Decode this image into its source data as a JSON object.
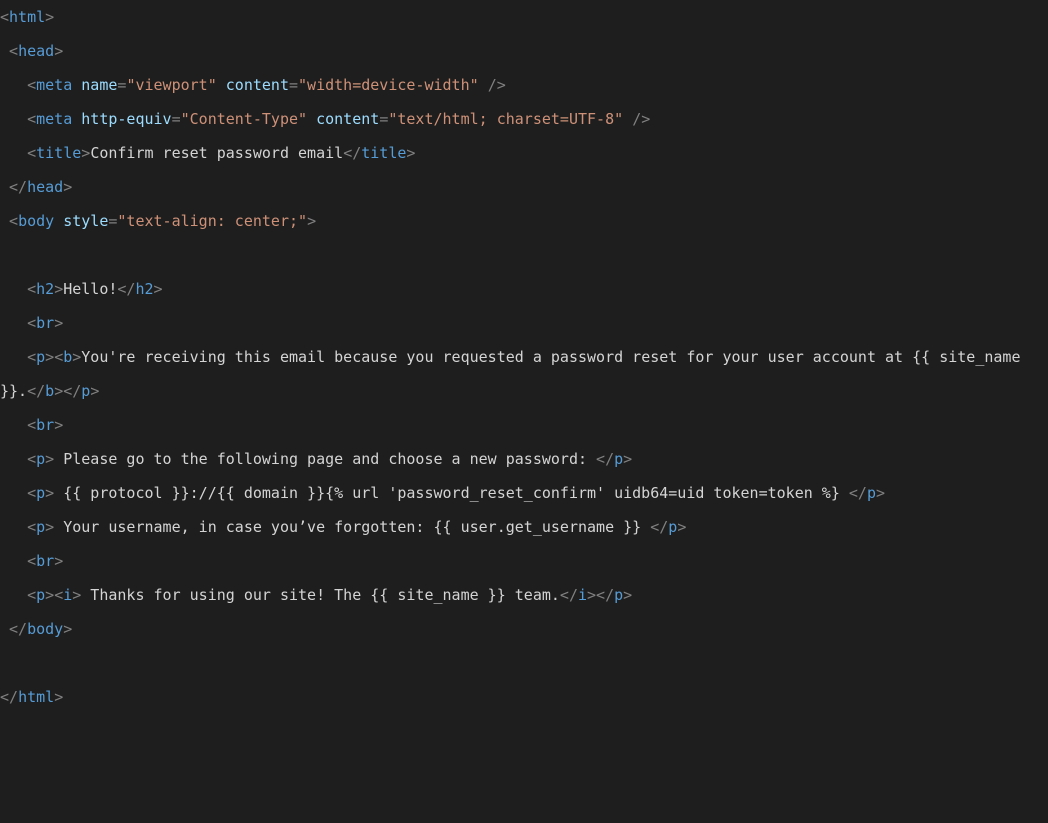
{
  "lines": [
    [
      {
        "cls": "punc",
        "t": "<"
      },
      {
        "cls": "tag",
        "t": "html"
      },
      {
        "cls": "punc",
        "t": ">"
      }
    ],
    [
      {
        "cls": "txt",
        "t": " "
      },
      {
        "cls": "punc",
        "t": "<"
      },
      {
        "cls": "tag",
        "t": "head"
      },
      {
        "cls": "punc",
        "t": ">"
      }
    ],
    [
      {
        "cls": "txt",
        "t": "   "
      },
      {
        "cls": "punc",
        "t": "<"
      },
      {
        "cls": "tag",
        "t": "meta"
      },
      {
        "cls": "txt",
        "t": " "
      },
      {
        "cls": "attr",
        "t": "name"
      },
      {
        "cls": "punc",
        "t": "="
      },
      {
        "cls": "str",
        "t": "\"viewport\""
      },
      {
        "cls": "txt",
        "t": " "
      },
      {
        "cls": "attr",
        "t": "content"
      },
      {
        "cls": "punc",
        "t": "="
      },
      {
        "cls": "str",
        "t": "\"width=device-width\""
      },
      {
        "cls": "txt",
        "t": " "
      },
      {
        "cls": "punc",
        "t": "/>"
      }
    ],
    [
      {
        "cls": "txt",
        "t": "   "
      },
      {
        "cls": "punc",
        "t": "<"
      },
      {
        "cls": "tag",
        "t": "meta"
      },
      {
        "cls": "txt",
        "t": " "
      },
      {
        "cls": "attr",
        "t": "http-equiv"
      },
      {
        "cls": "punc",
        "t": "="
      },
      {
        "cls": "str",
        "t": "\"Content-Type\""
      },
      {
        "cls": "txt",
        "t": " "
      },
      {
        "cls": "attr",
        "t": "content"
      },
      {
        "cls": "punc",
        "t": "="
      },
      {
        "cls": "str",
        "t": "\"text/html; charset=UTF-8\""
      },
      {
        "cls": "txt",
        "t": " "
      },
      {
        "cls": "punc",
        "t": "/>"
      }
    ],
    [
      {
        "cls": "txt",
        "t": "   "
      },
      {
        "cls": "punc",
        "t": "<"
      },
      {
        "cls": "tag",
        "t": "title"
      },
      {
        "cls": "punc",
        "t": ">"
      },
      {
        "cls": "txt",
        "t": "Confirm reset password email"
      },
      {
        "cls": "punc",
        "t": "</"
      },
      {
        "cls": "tag",
        "t": "title"
      },
      {
        "cls": "punc",
        "t": ">"
      }
    ],
    [
      {
        "cls": "txt",
        "t": " "
      },
      {
        "cls": "punc",
        "t": "</"
      },
      {
        "cls": "tag",
        "t": "head"
      },
      {
        "cls": "punc",
        "t": ">"
      }
    ],
    [
      {
        "cls": "txt",
        "t": " "
      },
      {
        "cls": "punc",
        "t": "<"
      },
      {
        "cls": "tag",
        "t": "body"
      },
      {
        "cls": "txt",
        "t": " "
      },
      {
        "cls": "attr",
        "t": "style"
      },
      {
        "cls": "punc",
        "t": "="
      },
      {
        "cls": "str",
        "t": "\"text-align: center;\""
      },
      {
        "cls": "punc",
        "t": ">"
      }
    ],
    [
      {
        "cls": "txt",
        "t": ""
      }
    ],
    [
      {
        "cls": "txt",
        "t": "   "
      },
      {
        "cls": "punc",
        "t": "<"
      },
      {
        "cls": "tag",
        "t": "h2"
      },
      {
        "cls": "punc",
        "t": ">"
      },
      {
        "cls": "txt",
        "t": "Hello!"
      },
      {
        "cls": "punc",
        "t": "</"
      },
      {
        "cls": "tag",
        "t": "h2"
      },
      {
        "cls": "punc",
        "t": ">"
      }
    ],
    [
      {
        "cls": "txt",
        "t": "   "
      },
      {
        "cls": "punc",
        "t": "<"
      },
      {
        "cls": "tag",
        "t": "br"
      },
      {
        "cls": "punc",
        "t": ">"
      }
    ],
    [
      {
        "cls": "txt",
        "t": "   "
      },
      {
        "cls": "punc",
        "t": "<"
      },
      {
        "cls": "tag",
        "t": "p"
      },
      {
        "cls": "punc",
        "t": ">"
      },
      {
        "cls": "punc",
        "t": "<"
      },
      {
        "cls": "tag",
        "t": "b"
      },
      {
        "cls": "punc",
        "t": ">"
      },
      {
        "cls": "txt",
        "t": "You're receiving this email because you requested a password reset for your user account at {{ site_name }}."
      },
      {
        "cls": "punc",
        "t": "</"
      },
      {
        "cls": "tag",
        "t": "b"
      },
      {
        "cls": "punc",
        "t": ">"
      },
      {
        "cls": "punc",
        "t": "</"
      },
      {
        "cls": "tag",
        "t": "p"
      },
      {
        "cls": "punc",
        "t": ">"
      }
    ],
    [
      {
        "cls": "txt",
        "t": "   "
      },
      {
        "cls": "punc",
        "t": "<"
      },
      {
        "cls": "tag",
        "t": "br"
      },
      {
        "cls": "punc",
        "t": ">"
      }
    ],
    [
      {
        "cls": "txt",
        "t": "   "
      },
      {
        "cls": "punc",
        "t": "<"
      },
      {
        "cls": "tag",
        "t": "p"
      },
      {
        "cls": "punc",
        "t": ">"
      },
      {
        "cls": "txt",
        "t": " Please go to the following page and choose a new password: "
      },
      {
        "cls": "punc",
        "t": "</"
      },
      {
        "cls": "tag",
        "t": "p"
      },
      {
        "cls": "punc",
        "t": ">"
      }
    ],
    [
      {
        "cls": "txt",
        "t": "   "
      },
      {
        "cls": "punc",
        "t": "<"
      },
      {
        "cls": "tag",
        "t": "p"
      },
      {
        "cls": "punc",
        "t": ">"
      },
      {
        "cls": "txt",
        "t": " {{ protocol }}://{{ domain }}{% url 'password_reset_confirm' uidb64=uid token=token %} "
      },
      {
        "cls": "punc",
        "t": "</"
      },
      {
        "cls": "tag",
        "t": "p"
      },
      {
        "cls": "punc",
        "t": ">"
      }
    ],
    [
      {
        "cls": "txt",
        "t": "   "
      },
      {
        "cls": "punc",
        "t": "<"
      },
      {
        "cls": "tag",
        "t": "p"
      },
      {
        "cls": "punc",
        "t": ">"
      },
      {
        "cls": "txt",
        "t": " Your username, in case you’ve forgotten: {{ user.get_username }} "
      },
      {
        "cls": "punc",
        "t": "</"
      },
      {
        "cls": "tag",
        "t": "p"
      },
      {
        "cls": "punc",
        "t": ">"
      }
    ],
    [
      {
        "cls": "txt",
        "t": "   "
      },
      {
        "cls": "punc",
        "t": "<"
      },
      {
        "cls": "tag",
        "t": "br"
      },
      {
        "cls": "punc",
        "t": ">"
      }
    ],
    [
      {
        "cls": "txt",
        "t": "   "
      },
      {
        "cls": "punc",
        "t": "<"
      },
      {
        "cls": "tag",
        "t": "p"
      },
      {
        "cls": "punc",
        "t": ">"
      },
      {
        "cls": "punc",
        "t": "<"
      },
      {
        "cls": "tag",
        "t": "i"
      },
      {
        "cls": "punc",
        "t": ">"
      },
      {
        "cls": "txt",
        "t": " Thanks for using our site! The {{ site_name }} team."
      },
      {
        "cls": "punc",
        "t": "</"
      },
      {
        "cls": "tag",
        "t": "i"
      },
      {
        "cls": "punc",
        "t": ">"
      },
      {
        "cls": "punc",
        "t": "</"
      },
      {
        "cls": "tag",
        "t": "p"
      },
      {
        "cls": "punc",
        "t": ">"
      }
    ],
    [
      {
        "cls": "txt",
        "t": " "
      },
      {
        "cls": "punc",
        "t": "</"
      },
      {
        "cls": "tag",
        "t": "body"
      },
      {
        "cls": "punc",
        "t": ">"
      }
    ],
    [
      {
        "cls": "txt",
        "t": ""
      }
    ],
    [
      {
        "cls": "punc",
        "t": "</"
      },
      {
        "cls": "tag",
        "t": "html"
      },
      {
        "cls": "punc",
        "t": ">"
      }
    ]
  ]
}
